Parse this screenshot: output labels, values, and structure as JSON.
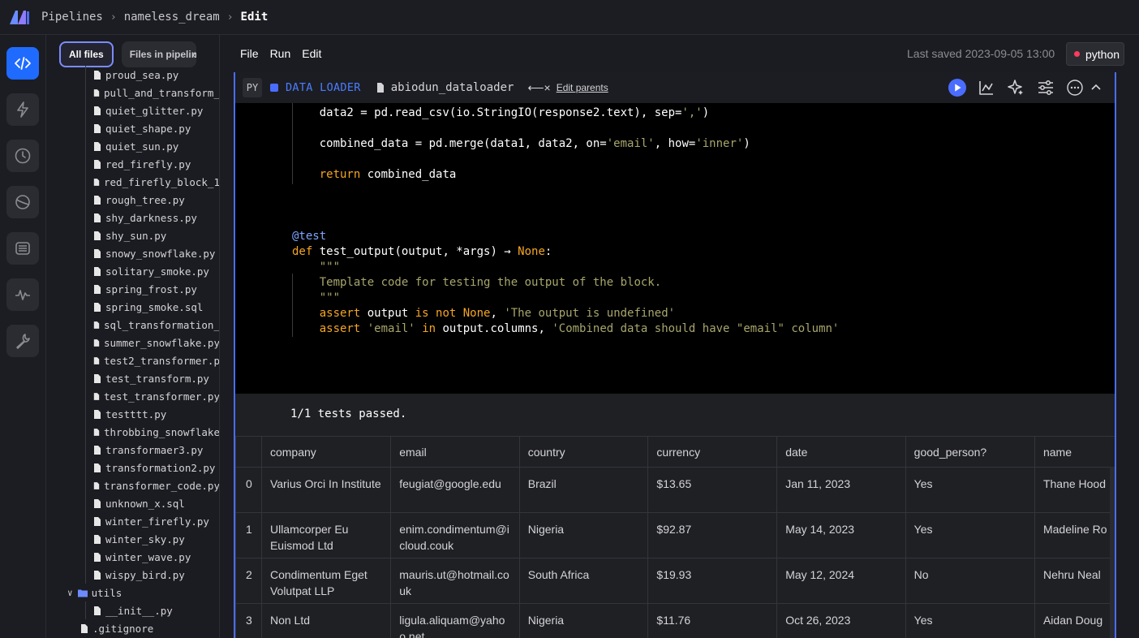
{
  "breadcrumb": {
    "root": "Pipelines",
    "pipeline": "nameless_dream",
    "current": "Edit"
  },
  "file_panel": {
    "tabs": [
      "All files",
      "Files in pipeline"
    ],
    "files": [
      "proud_sea.py",
      "pull_and_transform_",
      "quiet_glitter.py",
      "quiet_shape.py",
      "quiet_sun.py",
      "red_firefly.py",
      "red_firefly_block_1",
      "rough_tree.py",
      "shy_darkness.py",
      "shy_sun.py",
      "snowy_snowflake.py",
      "solitary_smoke.py",
      "spring_frost.py",
      "spring_smoke.sql",
      "sql_transformation_",
      "summer_snowflake.py",
      "test2_transformer.p",
      "test_transform.py",
      "test_transformer.py",
      "testttt.py",
      "throbbing_snowflake",
      "transformaer3.py",
      "transformation2.py",
      "transformer_code.py",
      "unknown_x.sql",
      "winter_firefly.py",
      "winter_sky.py",
      "winter_wave.py",
      "wispy_bird.py"
    ],
    "folder": "utils",
    "folder_files": [
      "__init__.py"
    ],
    "root_files": [
      ".gitignore"
    ]
  },
  "menu": [
    "File",
    "Run",
    "Edit"
  ],
  "last_saved": "Last saved 2023-09-05 13:00",
  "kernel": "python",
  "block": {
    "lang": "PY",
    "type": "DATA LOADER",
    "name": "abiodun_dataloader",
    "parents_arrow": "⟵×",
    "edit_parents": "Edit parents"
  },
  "test_result": "1/1 tests passed.",
  "table": {
    "columns": [
      "",
      "company",
      "email",
      "country",
      "currency",
      "date",
      "good_person?",
      "name"
    ],
    "rows": [
      [
        "0",
        "Varius Orci In Institute",
        "feugiat@google.edu",
        "Brazil",
        "$13.65",
        "Jan 11, 2023",
        "Yes",
        "Thane Hood"
      ],
      [
        "1",
        "Ullamcorper Eu Euismod Ltd",
        "enim.condimentum@icloud.couk",
        "Nigeria",
        "$92.87",
        "May 14, 2023",
        "Yes",
        "Madeline Ro"
      ],
      [
        "2",
        "Condimentum Eget Volutpat LLP",
        "mauris.ut@hotmail.couk",
        "South Africa",
        "$19.93",
        "May 12, 2024",
        "No",
        "Nehru Neal"
      ],
      [
        "3",
        "Non Ltd",
        "ligula.aliquam@yahoo.net",
        "Nigeria",
        "$11.76",
        "Oct 26, 2023",
        "Yes",
        "Aidan Doug"
      ]
    ]
  },
  "colors": {
    "accent": "#1f6bff",
    "block_border": "#4a6dff",
    "keyword": "#f5a623",
    "string": "#a8a66c"
  }
}
